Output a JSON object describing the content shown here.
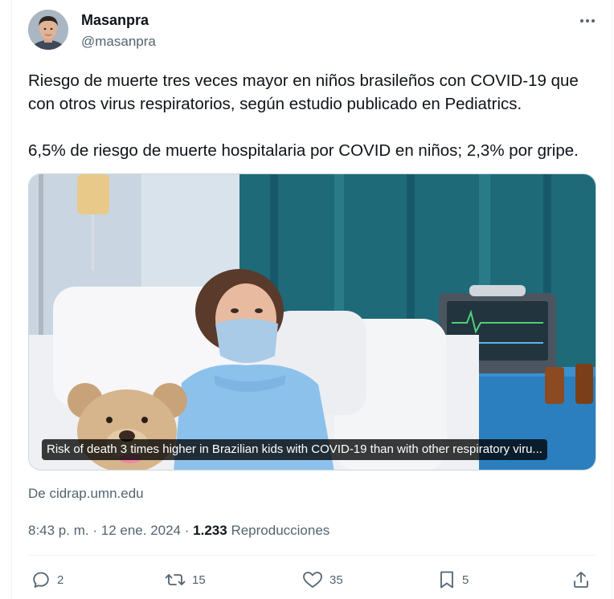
{
  "author": {
    "name": "Masanpra",
    "handle": "@masanpra"
  },
  "tweet": {
    "line1": "Riesgo de muerte tres veces mayor en niños brasileños con COVID-19 que",
    "line2": "con otros virus respiratorios, según estudio publicado en Pediatrics.",
    "line3": "6,5% de riesgo de muerte hospitalaria por COVID en niños; 2,3% por gripe."
  },
  "media": {
    "caption": "Risk of death 3 times higher in Brazilian kids with COVID-19 than with other respiratory viru..."
  },
  "source": "De cidrap.umn.edu",
  "meta": {
    "time": "8:43 p. m.",
    "separator": "·",
    "date": "12 ene. 2024",
    "views": "1.233",
    "views_label": "Reproducciones"
  },
  "actions": {
    "replies": "2",
    "retweets": "15",
    "likes": "35",
    "bookmarks": "5"
  },
  "colors": {
    "text": "#0f1419",
    "secondary": "#536471",
    "border": "#eff3f4"
  }
}
